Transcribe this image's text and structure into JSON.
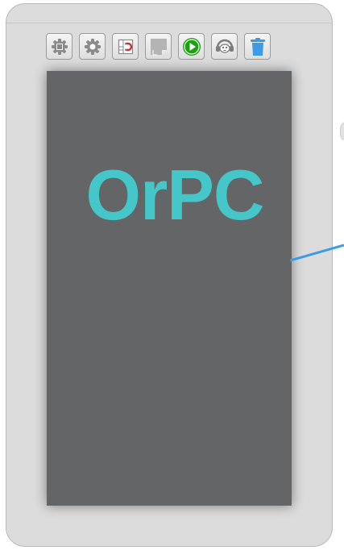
{
  "screen": {
    "title": "OrPC",
    "background_color": "#646567",
    "title_color": "#45c6c9"
  },
  "toolbar": {
    "buttons": [
      {
        "id": "cpu-settings",
        "icon": "chip-gear-icon"
      },
      {
        "id": "settings",
        "icon": "gear-icon"
      },
      {
        "id": "magnet-grid",
        "icon": "magnet-icon"
      },
      {
        "id": "page",
        "icon": "page-icon"
      },
      {
        "id": "run",
        "icon": "play-icon",
        "color": "#1aa30f"
      },
      {
        "id": "headphones",
        "icon": "headphones-icon"
      },
      {
        "id": "delete",
        "icon": "trash-icon",
        "color": "#3d9be6"
      }
    ]
  },
  "connector": {
    "color": "#3d9be6"
  }
}
